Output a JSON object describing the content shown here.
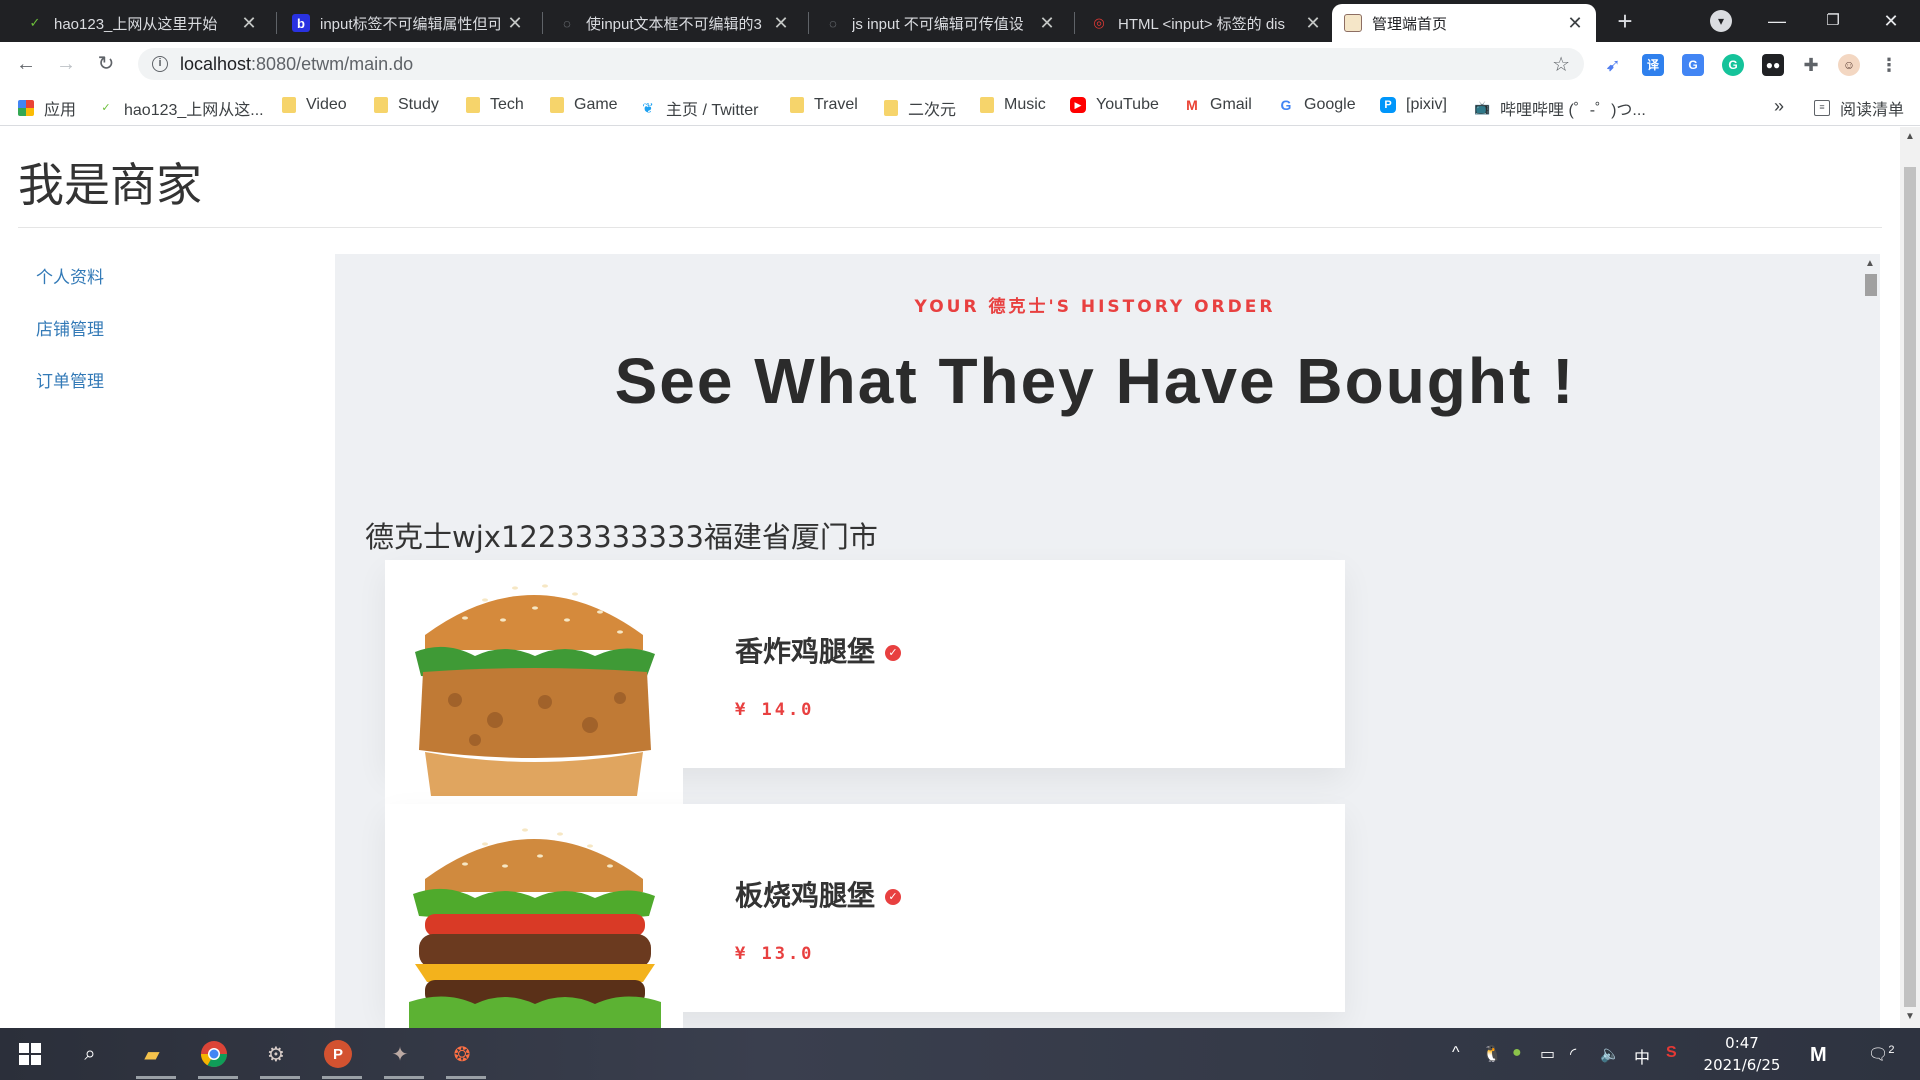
{
  "tabs": [
    {
      "title": "hao123_上网从这里开始",
      "active": false
    },
    {
      "title": "input标签不可编辑属性但可",
      "active": false
    },
    {
      "title": "使input文本框不可编辑的3",
      "active": false
    },
    {
      "title": "js input 不可编辑可传值设",
      "active": false
    },
    {
      "title": "HTML <input> 标签的 dis",
      "active": false
    },
    {
      "title": "管理端首页",
      "active": true
    }
  ],
  "address": {
    "host": "localhost",
    "path": ":8080/etwm/main.do"
  },
  "bookmarks": [
    {
      "label": "应用",
      "icon": "apps-grid-icon"
    },
    {
      "label": "hao123_上网从这...",
      "icon": "hao123-icon"
    },
    {
      "label": "Video",
      "icon": "folder-icon"
    },
    {
      "label": "Study",
      "icon": "folder-icon"
    },
    {
      "label": "Tech",
      "icon": "folder-icon"
    },
    {
      "label": "Game",
      "icon": "folder-icon"
    },
    {
      "label": "主页 / Twitter",
      "icon": "twitter-icon"
    },
    {
      "label": "Travel",
      "icon": "folder-icon"
    },
    {
      "label": "二次元",
      "icon": "folder-icon"
    },
    {
      "label": "Music",
      "icon": "folder-icon"
    },
    {
      "label": "YouTube",
      "icon": "youtube-icon"
    },
    {
      "label": "Gmail",
      "icon": "gmail-icon"
    },
    {
      "label": "Google",
      "icon": "google-icon"
    },
    {
      "label": "[pixiv]",
      "icon": "pixiv-icon"
    },
    {
      "label": "哔哩哔哩 (゜-゜)つ...",
      "icon": "bilibili-icon"
    }
  ],
  "reading_list": "阅读清单",
  "page": {
    "title": "我是商家",
    "nav": [
      "个人资料",
      "店铺管理",
      "订单管理"
    ],
    "subheading": "YOUR 德克士'S HISTORY ORDER",
    "heading": "See What They Have Bought !",
    "customer": "德克士wjx12233333333福建省厦门市",
    "orders": [
      {
        "name": "香炸鸡腿堡",
        "price": "¥ 14.0"
      },
      {
        "name": "板烧鸡腿堡",
        "price": "¥ 13.0"
      }
    ]
  },
  "taskbar": {
    "time": "0:47",
    "date": "2021/6/25",
    "ime": "中",
    "notifications": "2"
  },
  "colors": {
    "accent_red": "#e84040",
    "link_blue": "#337ab7",
    "panel_bg": "#eef0f3"
  }
}
